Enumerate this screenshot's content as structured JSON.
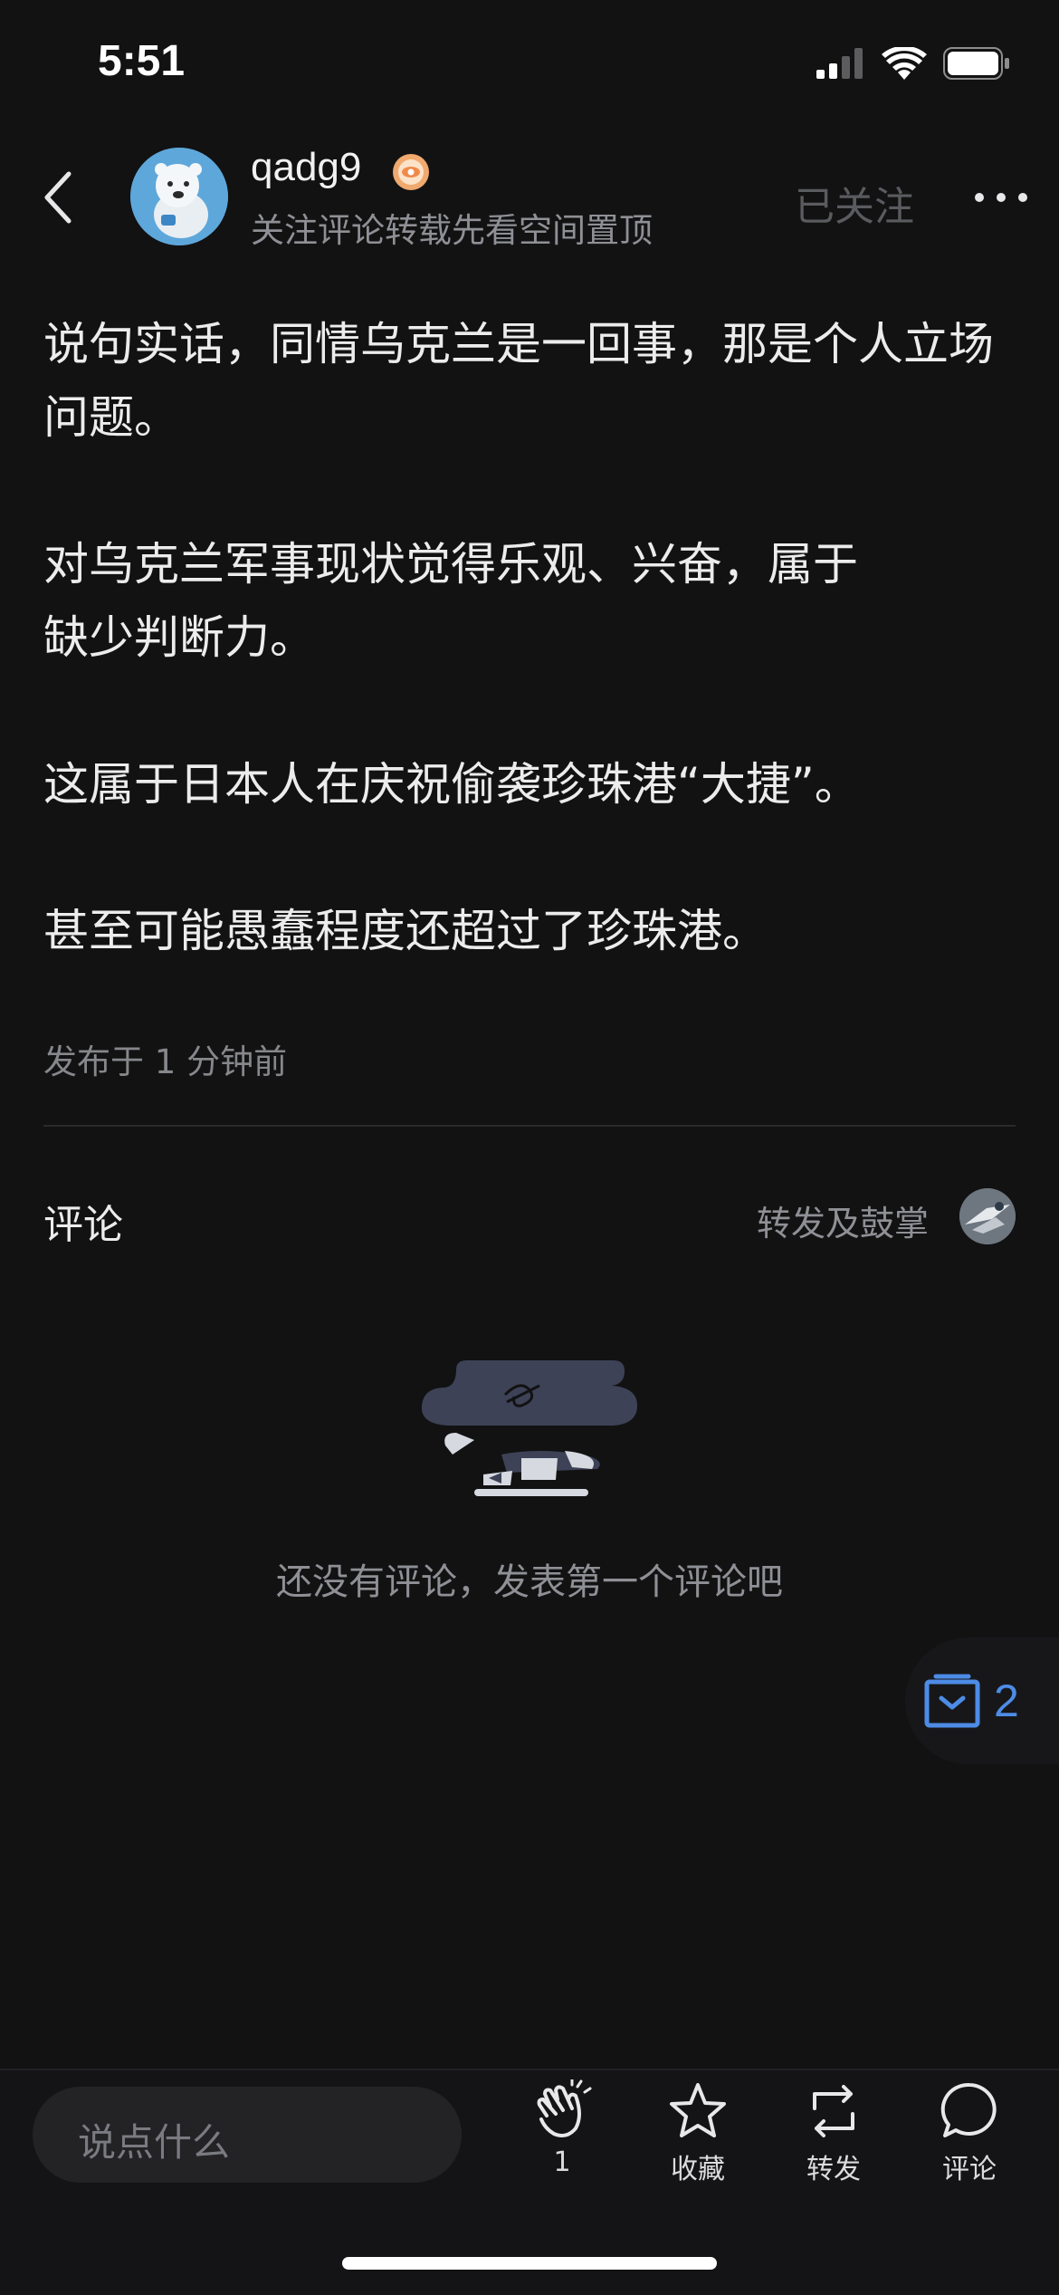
{
  "status_bar": {
    "time": "5:51"
  },
  "header": {
    "username": "qadg9",
    "subtitle": "关注评论转载先看空间置顶",
    "follow_state": "已关注"
  },
  "post": {
    "paragraphs": [
      "说句实话，同情乌克兰是一回事，那是个人立场问题。",
      "对乌克兰军事现状觉得乐观、兴奋，属于缺少判断力。",
      "这属于日本人在庆祝偷袭珍珠港“大捷”。",
      "甚至可能愚蠢程度还超过了珍珠港。"
    ],
    "published": "发布于 1 分钟前"
  },
  "comments": {
    "title": "评论",
    "reposts_label": "转发及鼓掌",
    "empty_text": "还没有评论，发表第一个评论吧"
  },
  "floating": {
    "count": "2"
  },
  "bottom_bar": {
    "input_placeholder": "说点什么",
    "clap_count": "1",
    "favorite_label": "收藏",
    "repost_label": "转发",
    "comment_label": "评论"
  },
  "colors": {
    "background": "#121213",
    "accent_blue": "#4d8ce6",
    "muted_text": "#8f9095"
  }
}
